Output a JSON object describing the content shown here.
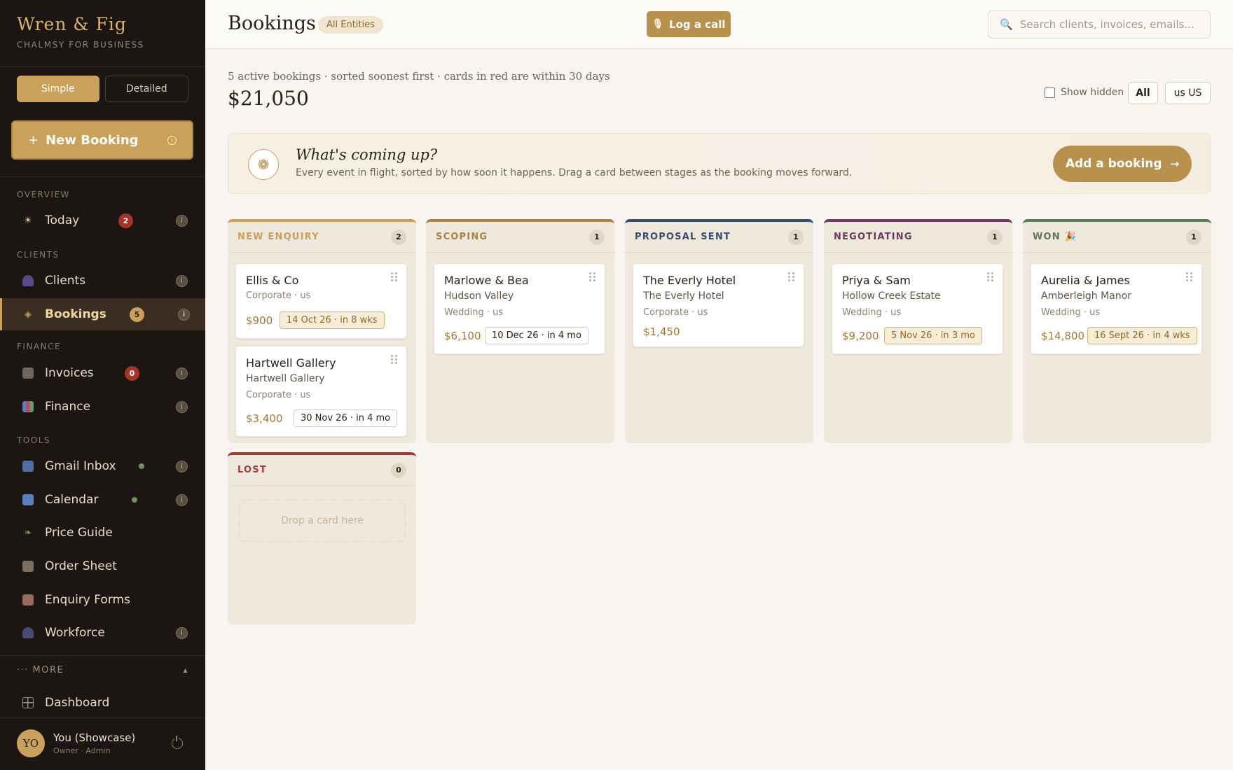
{
  "sidebar": {
    "brand_title": "Wren & Fig",
    "brand_subtitle": "CHALMSY FOR BUSINESS",
    "mode_simple": "Simple",
    "mode_detailed": "Detailed",
    "new_booking_plus": "+",
    "new_booking_label": "New Booking",
    "sections": {
      "overview": "OVERVIEW",
      "clients": "CLIENTS",
      "finance": "FINANCE",
      "tools": "TOOLS"
    },
    "items": {
      "today": {
        "label": "Today",
        "badge": "2",
        "icon": "sun-icon"
      },
      "clients": {
        "label": "Clients",
        "icon": "person-icon"
      },
      "bookings": {
        "label": "Bookings",
        "badge": "5",
        "icon": "diamond-icon"
      },
      "invoices": {
        "label": "Invoices",
        "badge": "0",
        "icon": "receipt-icon"
      },
      "finance": {
        "label": "Finance",
        "icon": "bar-chart-icon"
      },
      "gmail": {
        "label": "Gmail Inbox",
        "icon": "mail-icon"
      },
      "calendar": {
        "label": "Calendar",
        "icon": "calendar-icon"
      },
      "price_guide": {
        "label": "Price Guide",
        "icon": "leaf-icon"
      },
      "order_sheet": {
        "label": "Order Sheet",
        "icon": "scroll-icon"
      },
      "enquiry_forms": {
        "label": "Enquiry Forms",
        "icon": "memo-icon"
      },
      "workforce": {
        "label": "Workforce",
        "icon": "people-icon"
      },
      "dashboard": {
        "label": "Dashboard",
        "icon": "grid-icon"
      }
    },
    "more_label": "··· MORE",
    "user": {
      "initials": "YO",
      "name": "You (Showcase)",
      "role": "Owner · Admin"
    }
  },
  "header": {
    "title": "Bookings",
    "entity_badge": "All Entities",
    "log_call": "Log a call",
    "search_placeholder": "Search clients, invoices, emails..."
  },
  "summary": {
    "text": "5 active bookings · sorted soonest first · cards in red are within 30 days",
    "total": "$21,050",
    "show_hidden": "Show hidden",
    "filter_all": "All",
    "filter_region": "us US"
  },
  "coming_up": {
    "title": "What's coming up?",
    "subtitle": "Every event in flight, sorted by how soon it happens. Drag a card between stages as the booking moves forward.",
    "button": "Add a booking"
  },
  "columns": [
    {
      "title": "NEW ENQUIRY",
      "count": "2",
      "color": "#c9a15a",
      "cards": [
        {
          "name": "Ellis & Co",
          "type": "Corporate · us",
          "amount": "$900",
          "date": "14 Oct 26 · in 8 wks"
        },
        {
          "name": "Hartwell Gallery",
          "venue": "Hartwell Gallery",
          "type": "Corporate · us",
          "amount": "$3,400",
          "date": "30 Nov 26 · in 4 mo"
        }
      ]
    },
    {
      "title": "SCOPING",
      "count": "1",
      "color": "#a88445",
      "cards": [
        {
          "name": "Marlowe & Bea",
          "venue": "Hudson Valley",
          "type": "Wedding · us",
          "amount": "$6,100",
          "date": "10 Dec 26 · in 4 mo"
        }
      ]
    },
    {
      "title": "PROPOSAL SENT",
      "count": "1",
      "color": "#3b4d6a",
      "cards": [
        {
          "name": "The Everly Hotel",
          "venue": "The Everly Hotel",
          "type": "Corporate · us",
          "amount": "$1,450"
        }
      ]
    },
    {
      "title": "NEGOTIATING",
      "count": "1",
      "color": "#6a3d5a",
      "cards": [
        {
          "name": "Priya & Sam",
          "venue": "Hollow Creek Estate",
          "type": "Wedding · us",
          "amount": "$9,200",
          "date": "5 Nov 26 · in 3 mo"
        }
      ]
    },
    {
      "title": "WON 🎉",
      "count": "1",
      "color": "#5e7a55",
      "cards": [
        {
          "name": "Aurelia & James",
          "venue": "Amberleigh Manor",
          "type": "Wedding · us",
          "amount": "$14,800",
          "date": "16 Sept 26 · in 4 wks"
        }
      ]
    },
    {
      "title": "LOST",
      "count": "0",
      "color": "#a83a3a",
      "drop_text": "Drop a card here"
    }
  ],
  "colors": {
    "accent": "#c9a15a",
    "sidebar_bg": "#1c1612",
    "danger_badge": "#a83226"
  }
}
